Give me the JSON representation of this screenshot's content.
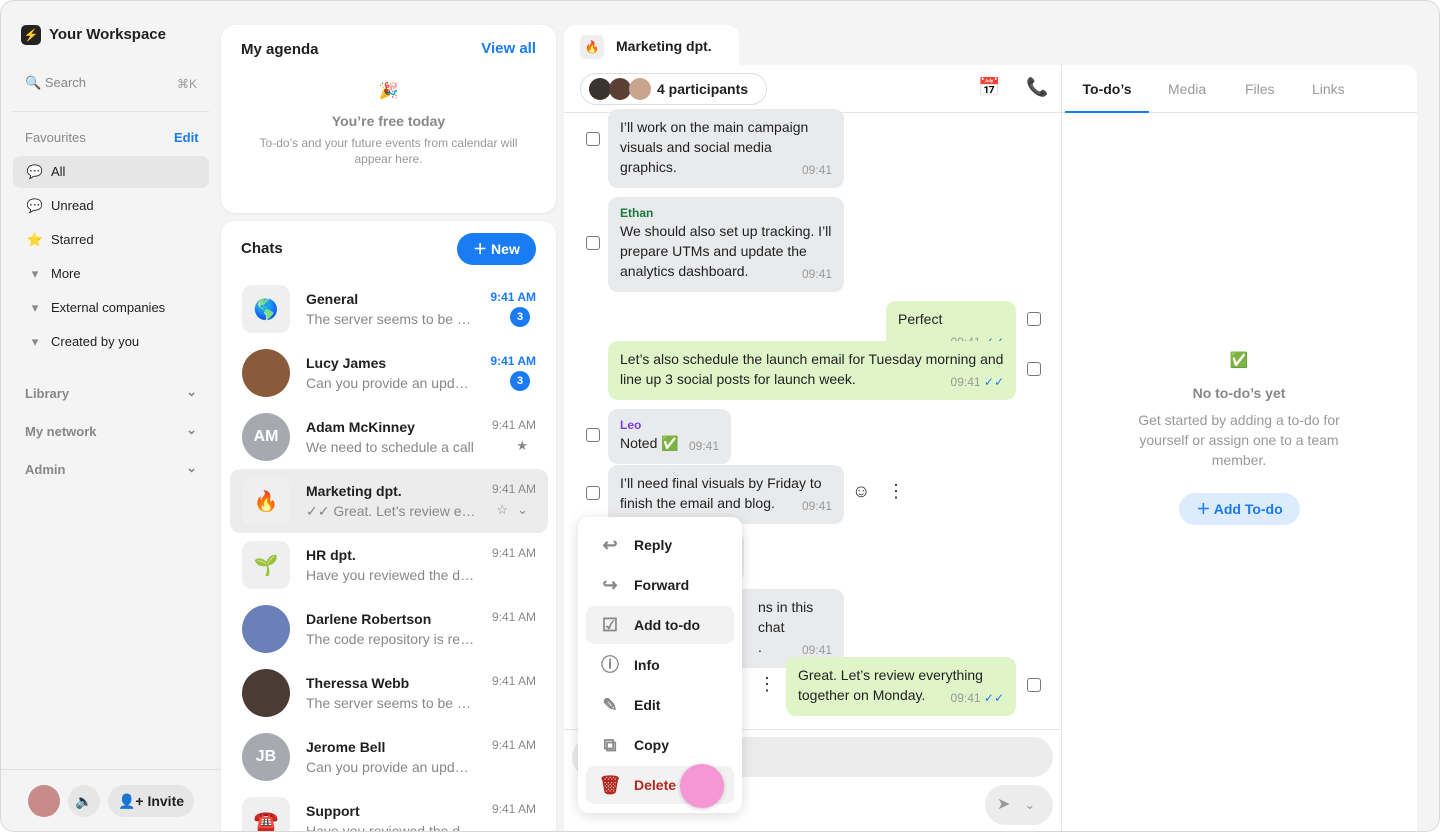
{
  "sidebar": {
    "workspace": "Your Workspace",
    "search": "Search",
    "shortcut": "⌘K",
    "favourites": "Favourites",
    "edit": "Edit",
    "items": [
      {
        "label": "All",
        "icon": "speech-bubble-icon"
      },
      {
        "label": "Unread",
        "icon": "speech-bubble-dot-icon"
      },
      {
        "label": "Starred",
        "icon": "star-icon"
      },
      {
        "label": "More",
        "icon": "caret-down-icon"
      },
      {
        "label": "External companies",
        "icon": "caret-down-icon"
      },
      {
        "label": "Created by you",
        "icon": "caret-down-icon"
      }
    ],
    "sections": [
      "Library",
      "My network",
      "Admin"
    ],
    "invite": "Invite"
  },
  "agenda": {
    "title": "My agenda",
    "view_all": "View all",
    "empty_title": "You’re free today",
    "empty_text": "To-do’s and your future events from calendar will appear here."
  },
  "chats": {
    "title": "Chats",
    "new": "New",
    "list": [
      {
        "name": "General",
        "preview": "The server seems to be down",
        "time": "9:41 AM",
        "badge": "3",
        "bold": true,
        "icon": "🌎",
        "sq": true
      },
      {
        "name": "Lucy James",
        "preview": "Can you provide an update?",
        "time": "9:41 AM",
        "badge": "3",
        "bold": true,
        "color": "#8a5a3c"
      },
      {
        "name": "Adam McKinney",
        "preview": "We need to schedule a call",
        "time": "9:41 AM",
        "initials": "AM",
        "color": "#a7a9b0",
        "star": true
      },
      {
        "name": "Marketing dpt.",
        "preview": "✓✓ Great. Let’s review everything",
        "time": "9:41 AM",
        "icon": "🔥",
        "sq": true,
        "sel": true
      },
      {
        "name": "HR dpt.",
        "preview": "Have you reviewed the document?",
        "time": "9:41 AM",
        "icon": "🌱",
        "sq": true
      },
      {
        "name": "Darlene Robertson",
        "preview": "The code repository is ready",
        "time": "9:41 AM",
        "color": "#6b7fb8"
      },
      {
        "name": "Theressa Webb",
        "preview": "The server seems to be down",
        "time": "9:41 AM",
        "color": "#4a3b33"
      },
      {
        "name": "Jerome Bell",
        "preview": "Can you provide an update?",
        "time": "9:41 AM",
        "initials": "JB",
        "color": "#a7a9b0"
      },
      {
        "name": "Support",
        "preview": "Have you reviewed the document?",
        "time": "9:41 AM",
        "icon": "☎️",
        "sq": true
      }
    ]
  },
  "conversation": {
    "tab": "Marketing dpt.",
    "participants": "4 participants",
    "messages": [
      {
        "text": "I’ll work on the main campaign visuals and social media graphics.",
        "time": "09:41"
      },
      {
        "sender": "Ethan",
        "text": "We should also set up tracking. I’ll prepare UTMs and update the analytics dashboard.",
        "time": "09:41"
      },
      {
        "text": "Perfect",
        "time": "09:41"
      },
      {
        "text": "Let’s also schedule the launch email for Tuesday morning and line up 3 social posts for launch week.",
        "time": "09:41"
      },
      {
        "sender": "Leo",
        "text": "Noted ✅",
        "time": "09:41"
      },
      {
        "text": "I’ll need final visuals by Friday to finish the email and blog.",
        "time": "09:41"
      },
      {
        "text": "ns in this chat",
        "text2": ".",
        "time": "09:41"
      },
      {
        "text": "Great. Let’s review everything together on Monday.",
        "time": "09:41"
      }
    ],
    "menu": [
      "Reply",
      "Forward",
      "Add to-do",
      "Info",
      "Edit",
      "Copy",
      "Delete"
    ]
  },
  "right": {
    "tabs": [
      "To-do’s",
      "Media",
      "Files",
      "Links"
    ],
    "empty_title": "No to-do’s yet",
    "empty_text": "Get started by adding a to-do for yourself or assign one to a team member.",
    "add": "Add To-do"
  }
}
